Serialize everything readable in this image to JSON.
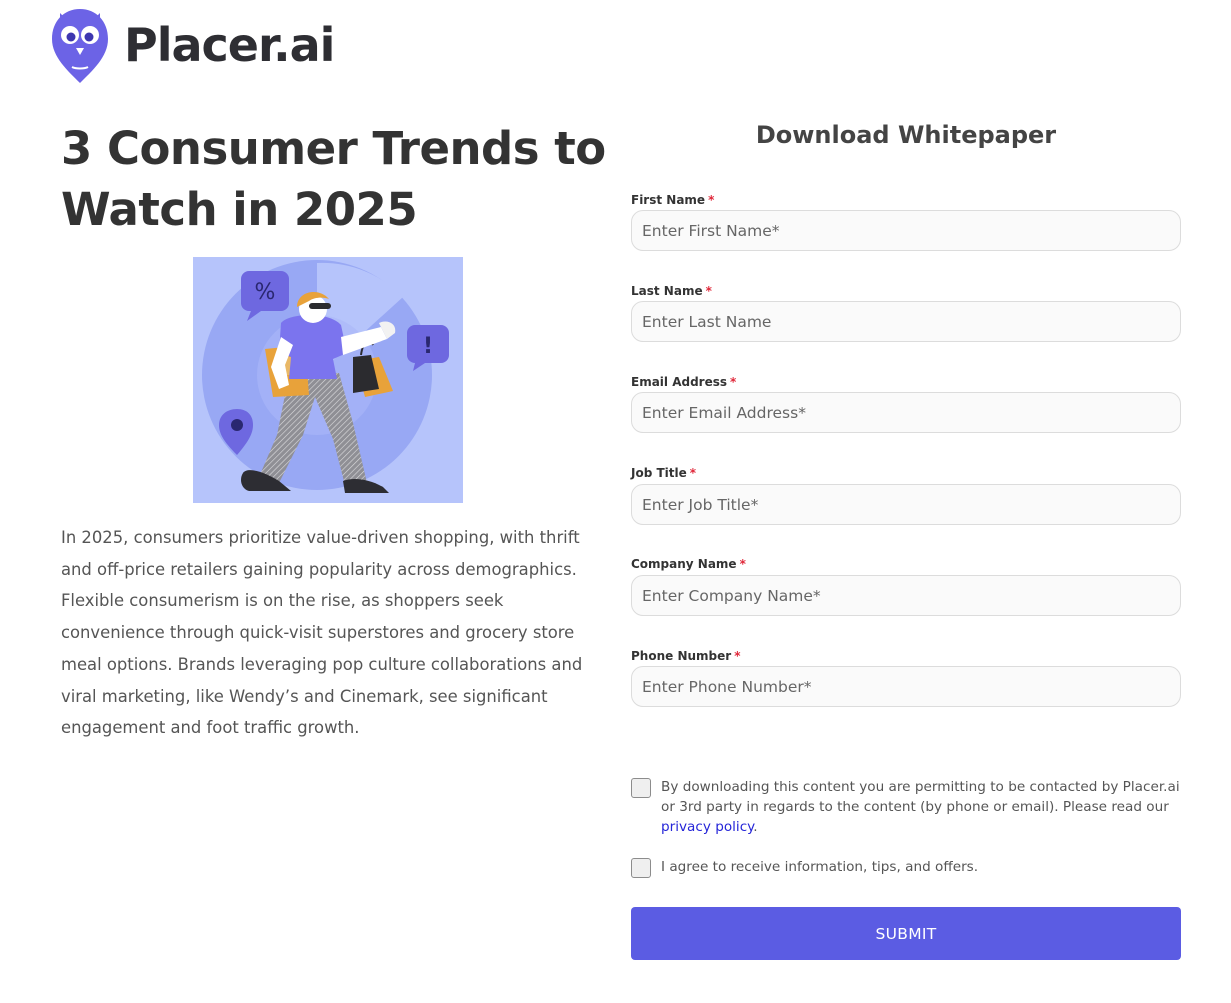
{
  "brand": {
    "name": "Placer.ai",
    "accent": "#5b5ce3",
    "logo_color": "#6c63e6"
  },
  "hero": {
    "title": "3 Consumer Trends to Watch in 2025",
    "image_icon": "shopper-illustration",
    "description": "In 2025, consumers prioritize value-driven shopping, with thrift and off-price retailers gaining popularity across demographics. Flexible consumerism is on the rise, as shoppers seek convenience through quick-visit superstores and grocery store meal options. Brands leveraging pop culture collaborations and viral marketing, like Wendy’s and Cinemark, see significant engagement and foot traffic growth."
  },
  "form": {
    "title": "Download Whitepaper",
    "required_mark": "*",
    "fields": [
      {
        "label": "First Name",
        "placeholder": "Enter First Name*"
      },
      {
        "label": "Last Name",
        "placeholder": "Enter Last Name"
      },
      {
        "label": "Email Address",
        "placeholder": "Enter Email Address*"
      },
      {
        "label": "Job Title",
        "placeholder": "Enter Job Title*"
      },
      {
        "label": "Company Name",
        "placeholder": "Enter Company Name*"
      },
      {
        "label": "Phone Number",
        "placeholder": "Enter Phone Number*"
      }
    ],
    "consent": {
      "text": "By downloading this content you are permitting to be contacted by Placer.ai or 3rd party in regards to the content (by phone or email). Please read our ",
      "link": "privacy policy",
      "suffix": "."
    },
    "offers_text": "I agree to receive information, tips, and offers.",
    "submit_label": "SUBMIT"
  }
}
